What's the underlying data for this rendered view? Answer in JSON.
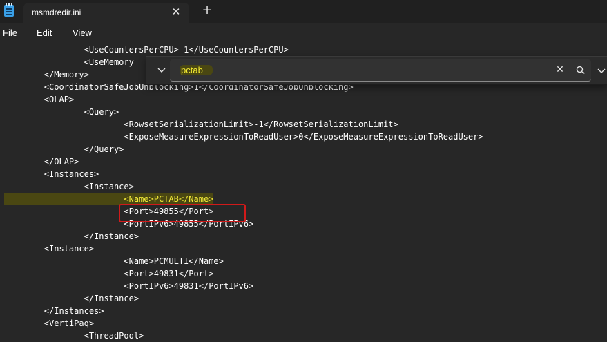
{
  "app": {
    "tab_title": "msmdredir.ini",
    "close_glyph": "✕",
    "new_tab_glyph": "+",
    "icon": "notepad-icon"
  },
  "menu": {
    "items": [
      "File",
      "Edit",
      "View"
    ]
  },
  "find": {
    "query": "pctab",
    "clear_glyph": "✕",
    "icons": [
      "chevron-down-icon",
      "close-icon",
      "search-icon",
      "chevron-down-icon"
    ]
  },
  "editor": {
    "lines": [
      "                <UseCountersPerCPU>-1</UseCountersPerCPU>",
      "                <UseMemory",
      "        </Memory>",
      "        <CoordinatorSafeJobUnblocking>1</CoordinatorSafeJobUnblocking>",
      "        <OLAP>",
      "                <Query>",
      "                        <RowsetSerializationLimit>-1</RowsetSerializationLimit>",
      "                        <ExposeMeasureExpressionToReadUser>0</ExposeMeasureExpressionToReadUser>",
      "                </Query>",
      "        </OLAP>",
      "        <Instances>",
      "                <Instance>",
      "                        <Name>PCTAB</Name>",
      "                        <Port>49855</Port>",
      "                        <PortIPv6>49855</PortIPv6>",
      "                </Instance>",
      "        <Instance>",
      "                        <Name>PCMULTI</Name>",
      "                        <Port>49831</Port>",
      "                        <PortIPv6>49831</PortIPv6>",
      "                </Instance>",
      "        </Instances>",
      "        <VertiPaq>",
      "                <ThreadPool>"
    ]
  },
  "colors": {
    "background": "#272727",
    "titlebar": "#202020",
    "highlight_text": "#f0e838",
    "annotation": "#d11a1a"
  }
}
